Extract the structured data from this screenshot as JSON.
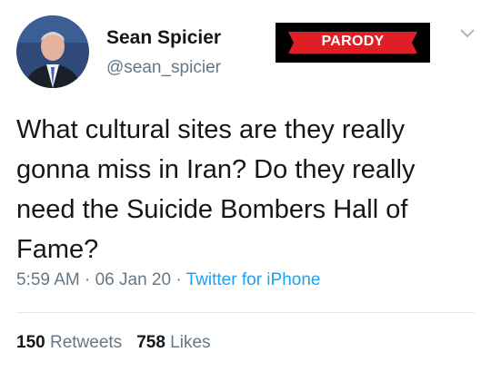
{
  "user": {
    "display_name": "Sean Spicier",
    "handle": "@sean_spicier",
    "avatar_icon": "profile-photo-man-in-suit",
    "badge_label": "PARODY"
  },
  "tweet": {
    "text": "What cultural sites are they really gonna miss in Iran? Do they really need the Suicide Bombers Hall of Fame?",
    "time": "5:59 AM",
    "date": "06 Jan 20",
    "source": "Twitter for iPhone",
    "separator": "·"
  },
  "stats": {
    "retweets_count": "150",
    "retweets_label": "Retweets",
    "likes_count": "758",
    "likes_label": "Likes"
  },
  "colors": {
    "text": "#14171a",
    "secondary": "#657786",
    "link": "#1da1f2",
    "banner_red": "#e01e26",
    "banner_black": "#000000",
    "divider": "#e1e8ed"
  },
  "icons": {
    "menu": "chevron-down-icon"
  }
}
